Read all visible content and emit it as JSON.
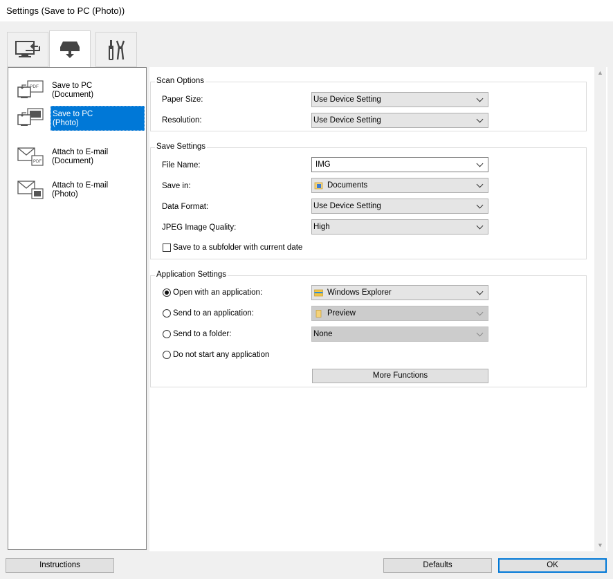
{
  "window": {
    "title": "Settings (Save to PC (Photo))"
  },
  "tabs": [
    {
      "icon": "computer-scan-icon"
    },
    {
      "icon": "scanner-save-icon"
    },
    {
      "icon": "tools-icon"
    }
  ],
  "sidebar": {
    "items": [
      {
        "line1": "Save to PC",
        "line2": "(Document)",
        "icon": "pdf-to-pc-icon"
      },
      {
        "line1": "Save to PC",
        "line2": "(Photo)",
        "icon": "photo-to-pc-icon"
      },
      {
        "line1": "Attach to E-mail",
        "line2": "(Document)",
        "icon": "mail-pdf-icon"
      },
      {
        "line1": "Attach to E-mail",
        "line2": "(Photo)",
        "icon": "mail-photo-icon"
      }
    ]
  },
  "scan_options": {
    "title": "Scan Options",
    "paper_size": {
      "label": "Paper Size:",
      "value": "Use Device Setting"
    },
    "resolution": {
      "label": "Resolution:",
      "value": "Use Device Setting"
    }
  },
  "save_settings": {
    "title": "Save Settings",
    "file_name": {
      "label": "File Name:",
      "value": "IMG"
    },
    "save_in": {
      "label": "Save in:",
      "value": "Documents"
    },
    "data_format": {
      "label": "Data Format:",
      "value": "Use Device Setting"
    },
    "jpeg_quality": {
      "label": "JPEG Image Quality:",
      "value": "High"
    },
    "subfolder": {
      "label": "Save to a subfolder with current date",
      "checked": false
    }
  },
  "app_settings": {
    "title": "Application Settings",
    "open_with": {
      "label": "Open with an application:",
      "value": "Windows Explorer",
      "selected": true
    },
    "send_to_app": {
      "label": "Send to an application:",
      "value": "Preview",
      "selected": false
    },
    "send_to_folder": {
      "label": "Send to a folder:",
      "value": "None",
      "selected": false
    },
    "do_not_start": {
      "label": "Do not start any application",
      "selected": false
    },
    "more_functions": "More Functions"
  },
  "footer": {
    "instructions": "Instructions",
    "defaults": "Defaults",
    "ok": "OK"
  },
  "colors": {
    "selection": "#0078d7",
    "background": "#f0f0f0"
  }
}
